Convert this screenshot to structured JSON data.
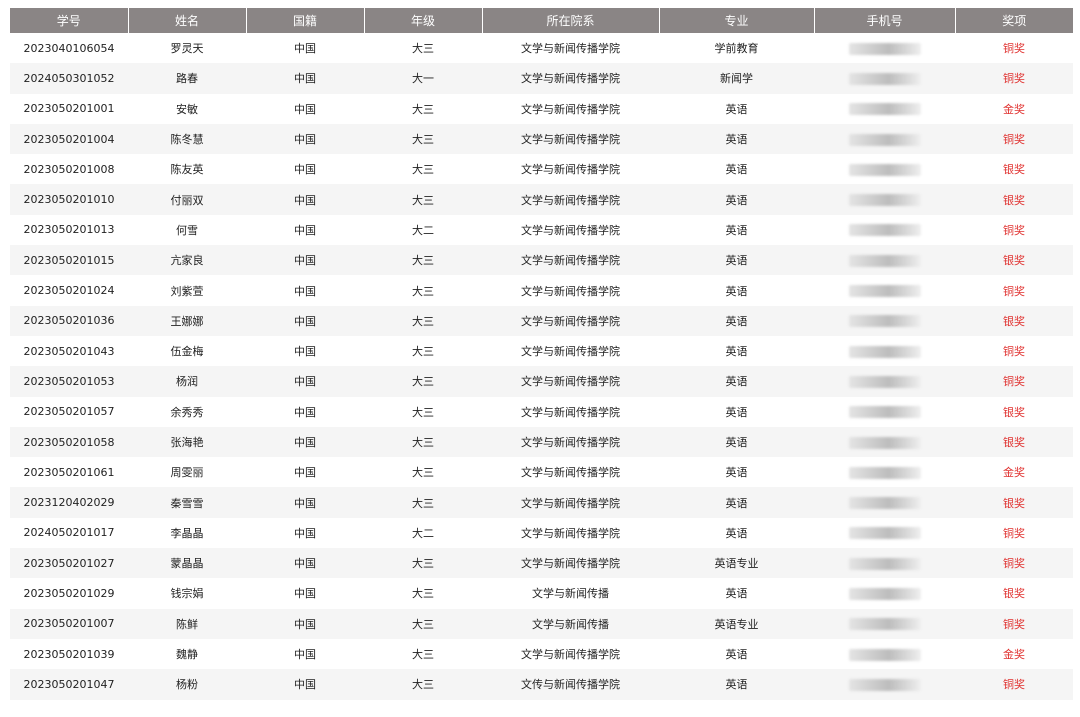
{
  "colors": {
    "header_bg": "#8a8585",
    "award_text": "#e0312f",
    "stripe": "#f5f5f5"
  },
  "headers": [
    "学号",
    "姓名",
    "国籍",
    "年级",
    "所在院系",
    "专业",
    "手机号",
    "奖项"
  ],
  "rows": [
    {
      "id": "2023040106054",
      "name": "罗灵天",
      "nation": "中国",
      "grade": "大三",
      "college": "文学与新闻传播学院",
      "major": "学前教育",
      "award": "铜奖"
    },
    {
      "id": "2024050301052",
      "name": "路春",
      "nation": "中国",
      "grade": "大一",
      "college": "文学与新闻传播学院",
      "major": "新闻学",
      "award": "铜奖"
    },
    {
      "id": "2023050201001",
      "name": "安敏",
      "nation": "中国",
      "grade": "大三",
      "college": "文学与新闻传播学院",
      "major": "英语",
      "award": "金奖"
    },
    {
      "id": "2023050201004",
      "name": "陈冬慧",
      "nation": "中国",
      "grade": "大三",
      "college": "文学与新闻传播学院",
      "major": "英语",
      "award": "铜奖"
    },
    {
      "id": "2023050201008",
      "name": "陈友英",
      "nation": "中国",
      "grade": "大三",
      "college": "文学与新闻传播学院",
      "major": "英语",
      "award": "银奖"
    },
    {
      "id": "2023050201010",
      "name": "付丽双",
      "nation": "中国",
      "grade": "大三",
      "college": "文学与新闻传播学院",
      "major": "英语",
      "award": "银奖"
    },
    {
      "id": "2023050201013",
      "name": "何雪",
      "nation": "中国",
      "grade": "大二",
      "college": "文学与新闻传播学院",
      "major": "英语",
      "award": "铜奖"
    },
    {
      "id": "2023050201015",
      "name": "亢家良",
      "nation": "中国",
      "grade": "大三",
      "college": "文学与新闻传播学院",
      "major": "英语",
      "award": "银奖"
    },
    {
      "id": "2023050201024",
      "name": "刘紫萱",
      "nation": "中国",
      "grade": "大三",
      "college": "文学与新闻传播学院",
      "major": "英语",
      "award": "铜奖"
    },
    {
      "id": "2023050201036",
      "name": "王娜娜",
      "nation": "中国",
      "grade": "大三",
      "college": "文学与新闻传播学院",
      "major": "英语",
      "award": "银奖"
    },
    {
      "id": "2023050201043",
      "name": "伍金梅",
      "nation": "中国",
      "grade": "大三",
      "college": "文学与新闻传播学院",
      "major": "英语",
      "award": "铜奖"
    },
    {
      "id": "2023050201053",
      "name": "杨润",
      "nation": "中国",
      "grade": "大三",
      "college": "文学与新闻传播学院",
      "major": "英语",
      "award": "铜奖"
    },
    {
      "id": "2023050201057",
      "name": "余秀秀",
      "nation": "中国",
      "grade": "大三",
      "college": "文学与新闻传播学院",
      "major": "英语",
      "award": "银奖"
    },
    {
      "id": "2023050201058",
      "name": "张海艳",
      "nation": "中国",
      "grade": "大三",
      "college": "文学与新闻传播学院",
      "major": "英语",
      "award": "银奖"
    },
    {
      "id": "2023050201061",
      "name": "周雯丽",
      "nation": "中国",
      "grade": "大三",
      "college": "文学与新闻传播学院",
      "major": "英语",
      "award": "金奖"
    },
    {
      "id": "2023120402029",
      "name": "秦雪雪",
      "nation": "中国",
      "grade": "大三",
      "college": "文学与新闻传播学院",
      "major": "英语",
      "award": "银奖"
    },
    {
      "id": "2024050201017",
      "name": "李晶晶",
      "nation": "中国",
      "grade": "大二",
      "college": "文学与新闻传播学院",
      "major": "英语",
      "award": "铜奖"
    },
    {
      "id": "2023050201027",
      "name": "蒙晶晶",
      "nation": "中国",
      "grade": "大三",
      "college": "文学与新闻传播学院",
      "major": "英语专业",
      "award": "铜奖"
    },
    {
      "id": "2023050201029",
      "name": "钱宗娟",
      "nation": "中国",
      "grade": "大三",
      "college": "文学与新闻传播",
      "major": "英语",
      "award": "银奖"
    },
    {
      "id": "2023050201007",
      "name": "陈鲜",
      "nation": "中国",
      "grade": "大三",
      "college": "文学与新闻传播",
      "major": "英语专业",
      "award": "铜奖"
    },
    {
      "id": "2023050201039",
      "name": "魏静",
      "nation": "中国",
      "grade": "大三",
      "college": "文学与新闻传播学院",
      "major": "英语",
      "award": "金奖"
    },
    {
      "id": "2023050201047",
      "name": "杨粉",
      "nation": "中国",
      "grade": "大三",
      "college": "文传与新闻传播学院",
      "major": "英语",
      "award": "铜奖"
    }
  ]
}
